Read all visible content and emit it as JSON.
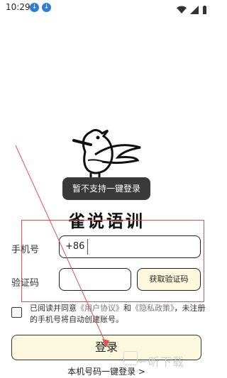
{
  "status_bar": {
    "time": "10:29",
    "icons": [
      "download-icon",
      "download-icon"
    ],
    "right_icons": [
      "wifi-icon",
      "signal-icon",
      "battery-icon"
    ]
  },
  "app": {
    "name": "雀说语训"
  },
  "toast": {
    "text": "暂不支持一键登录"
  },
  "form": {
    "phone_label": "手机号",
    "phone_prefix": "+86",
    "phone_value": "",
    "code_label": "验证码",
    "code_value": "",
    "get_code_label": "获取验证码"
  },
  "agreement": {
    "prefix": "已阅读并同意",
    "user_agreement": "《用户协议》",
    "and": "和",
    "privacy_policy": "《隐私政策》",
    "note": "，未注册的手机号将自动创建账号。"
  },
  "buttons": {
    "login": "登录",
    "one_key_login": "本机号码一键登录 >"
  },
  "watermark": {
    "text": "一昕下载"
  },
  "colors": {
    "button_bg": "#fbf8dd",
    "annotation_red": "#e35050",
    "toast_bg": "#3a3a3a"
  }
}
